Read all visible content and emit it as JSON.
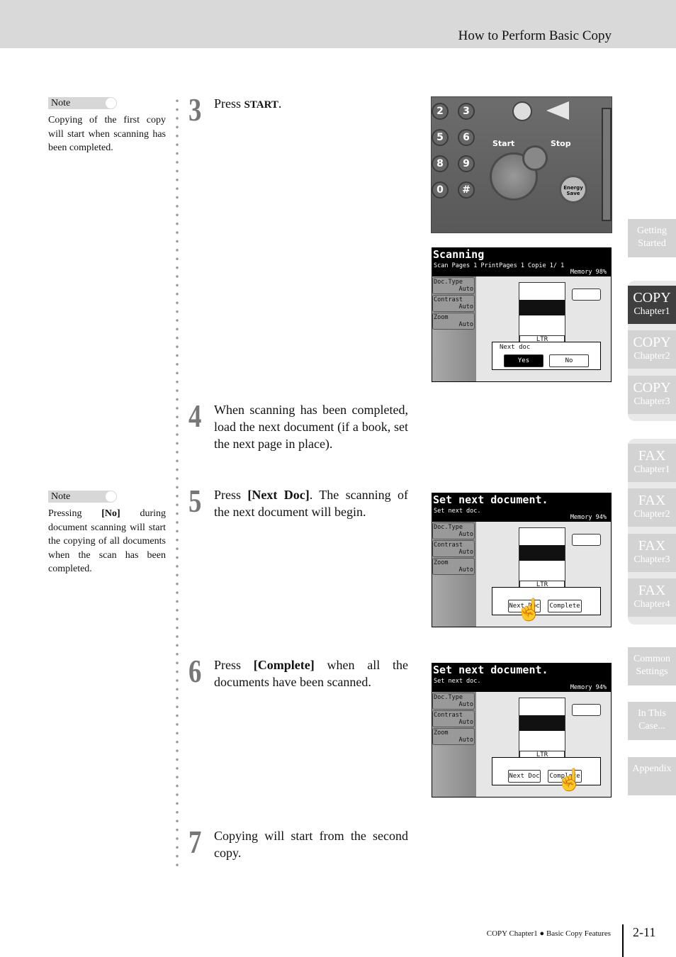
{
  "header": {
    "title": "How to Perform Basic Copy"
  },
  "notes": [
    {
      "tag": "Note",
      "text": "Copying of the first copy will start when scanning has been completed."
    },
    {
      "tag": "Note",
      "text_parts": [
        "Pressing ",
        "[No]",
        " during document scanning will start the copying of all documents when the scan has been completed."
      ]
    }
  ],
  "steps": [
    {
      "num": "3",
      "parts": [
        "Press ",
        "START",
        "."
      ]
    },
    {
      "num": "4",
      "text": "When scanning has been completed, load the next document (if a book, set the next page in place)."
    },
    {
      "num": "5",
      "parts": [
        "Press ",
        "[Next Doc]",
        ". The scanning of the next document will begin."
      ]
    },
    {
      "num": "6",
      "parts": [
        "Press ",
        "[Complete]",
        " when all the documents have been scanned."
      ]
    },
    {
      "num": "7",
      "text": "Copying will start from the second copy."
    }
  ],
  "panel": {
    "keys": [
      "2",
      "3",
      "5",
      "6",
      "8",
      "9",
      "0",
      "#"
    ],
    "start": "Start",
    "stop": "Stop",
    "energy": "Energy Save"
  },
  "screens": [
    {
      "title": "Scanning",
      "sub": "Scan Pages   1  PrintPages  1 Copie  1/  1",
      "memory": "Memory    98%",
      "left": [
        {
          "l": "Doc.Type",
          "v": "Auto"
        },
        {
          "l": "Contrast",
          "v": "Auto"
        },
        {
          "l": "Zoom",
          "v": "Auto"
        }
      ],
      "tray": "LTR",
      "dialog": "Next doc",
      "buttons": [
        "Yes",
        "No"
      ]
    },
    {
      "title": "Set next document.",
      "sub": "Set next doc.",
      "memory": "Memory    94%",
      "left": [
        {
          "l": "Doc.Type",
          "v": "Auto"
        },
        {
          "l": "Contrast",
          "v": "Auto"
        },
        {
          "l": "Zoom",
          "v": "Auto"
        }
      ],
      "tray": "LTR",
      "buttons": [
        "Next Doc",
        "Complete"
      ]
    },
    {
      "title": "Set next document.",
      "sub": "Set next doc.",
      "memory": "Memory    94%",
      "left": [
        {
          "l": "Doc.Type",
          "v": "Auto"
        },
        {
          "l": "Contrast",
          "v": "Auto"
        },
        {
          "l": "Zoom",
          "v": "Auto"
        }
      ],
      "tray": "LTR",
      "buttons": [
        "Next Doc",
        "Complete"
      ]
    }
  ],
  "sidebar": [
    {
      "a": "Getting",
      "b": "Started"
    },
    {
      "a": "COPY",
      "b": "Chapter1",
      "active": true
    },
    {
      "a": "COPY",
      "b": "Chapter2"
    },
    {
      "a": "COPY",
      "b": "Chapter3"
    },
    {
      "a": "FAX",
      "b": "Chapter1"
    },
    {
      "a": "FAX",
      "b": "Chapter2"
    },
    {
      "a": "FAX",
      "b": "Chapter3"
    },
    {
      "a": "FAX",
      "b": "Chapter4"
    },
    {
      "a": "Common",
      "b": "Settings"
    },
    {
      "a": "In This",
      "b": "Case..."
    },
    {
      "a": "Appendix"
    }
  ],
  "footer": {
    "chapter": "COPY Chapter1",
    "bullet": "●",
    "section": "Basic Copy Features",
    "page": "2-11"
  }
}
